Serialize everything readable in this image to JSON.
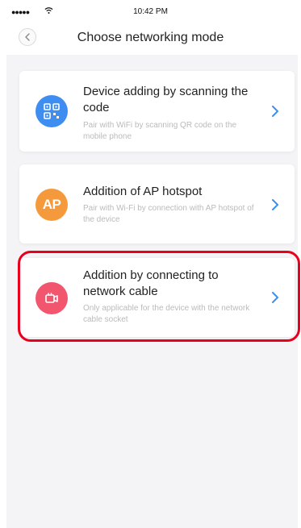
{
  "status_bar": {
    "signal": "●●●●●",
    "time": "10:42 PM"
  },
  "nav": {
    "title": "Choose networking mode"
  },
  "options": [
    {
      "title": "Device adding by scanning the code",
      "subtitle": "Pair with WiFi by scanning QR code on the mobile phone",
      "icon": "qr-code-icon",
      "color": "#3d8ef0"
    },
    {
      "title": "Addition of AP hotspot",
      "subtitle": "Pair with Wi-Fi by connection with AP hotspot of the device",
      "icon": "ap-hotspot-icon",
      "icon_text": "AP",
      "color": "#f59a3c"
    },
    {
      "title": "Addition by connecting to network cable",
      "subtitle": "Only applicable for the device with the network cable socket",
      "icon": "network-cable-icon",
      "color": "#f2566f"
    }
  ],
  "colors": {
    "chevron": "#3d8ef0",
    "highlight": "#e8001c",
    "background": "#f4f4f6"
  }
}
